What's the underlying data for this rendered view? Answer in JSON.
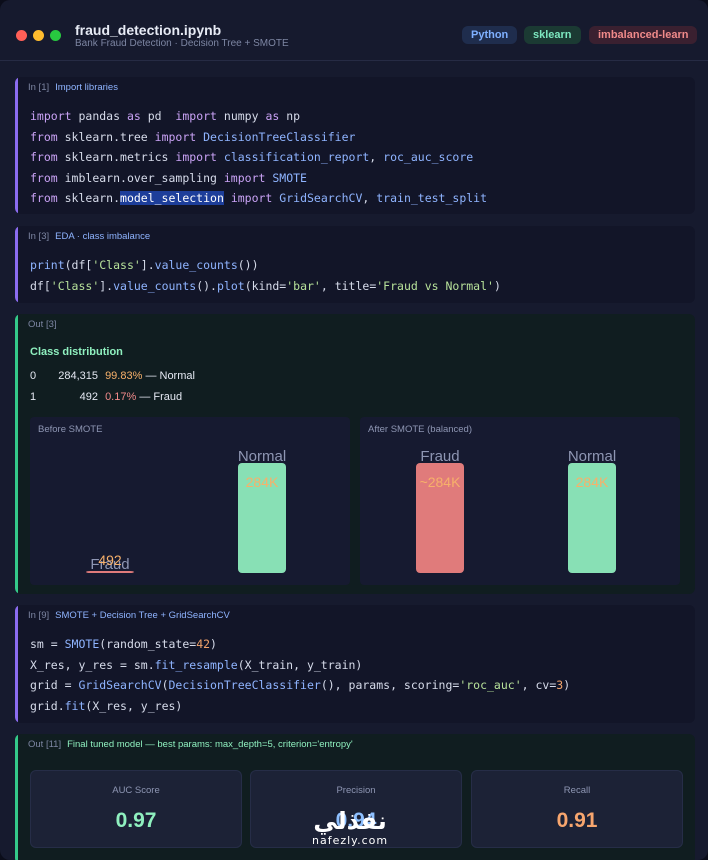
{
  "window": {
    "title": "fraud_detection.ipynb",
    "subtitle": "Bank Fraud Detection · Decision Tree + SMOTE",
    "tags": [
      {
        "label": "Python",
        "color": "#7fb0ff",
        "bg": "#1f2d4d"
      },
      {
        "label": "sklearn",
        "color": "#7de8c0",
        "bg": "#1b3a33"
      },
      {
        "label": "imbalanced-learn",
        "color": "#f08a8a",
        "bg": "#3a2030"
      }
    ]
  },
  "cells": {
    "c1": {
      "prompt": "In [1]",
      "label": "Import libraries"
    },
    "c2": {
      "prompt": "In [3]",
      "label": "EDA · class imbalance"
    },
    "c3": {
      "prompt": "Out [3]",
      "heading": "Class distribution",
      "rows": [
        {
          "idx": "0",
          "count": "284,315",
          "pct": "99.83%",
          "name": "— Normal"
        },
        {
          "idx": "1",
          "count": "492",
          "pct": "0.17%",
          "name": "— Fraud"
        }
      ]
    },
    "c4": {
      "prompt": "In [9]",
      "label": "SMOTE + Decision Tree + GridSearchCV"
    },
    "c5": {
      "prompt": "Out [11]",
      "label": "Final tuned model — best params: max_depth=5, criterion='entropy'",
      "metrics": [
        {
          "label": "AUC Score",
          "value": "0.97",
          "color": "#8ff0bf"
        },
        {
          "label": "Precision",
          "value": "0.94",
          "color": "#8ec0ff"
        },
        {
          "label": "Recall",
          "value": "0.91",
          "color": "#f7a66e"
        }
      ]
    }
  },
  "chart_data": [
    {
      "type": "bar",
      "title": "Before SMOTE",
      "categories": [
        "Fraud",
        "Normal"
      ],
      "values": [
        492,
        284315
      ],
      "value_labels": [
        "492",
        "284K"
      ],
      "colors": [
        "#e07b7b",
        "#88e0b5"
      ]
    },
    {
      "type": "bar",
      "title": "After SMOTE (balanced)",
      "categories": [
        "Fraud",
        "Normal"
      ],
      "values": [
        284315,
        284315
      ],
      "value_labels": [
        "~284K",
        "284K"
      ],
      "colors": [
        "#e07b7b",
        "#88e0b5"
      ]
    }
  ],
  "watermark": {
    "arabic": "نفذلي",
    "latin": "nafezly.com"
  }
}
